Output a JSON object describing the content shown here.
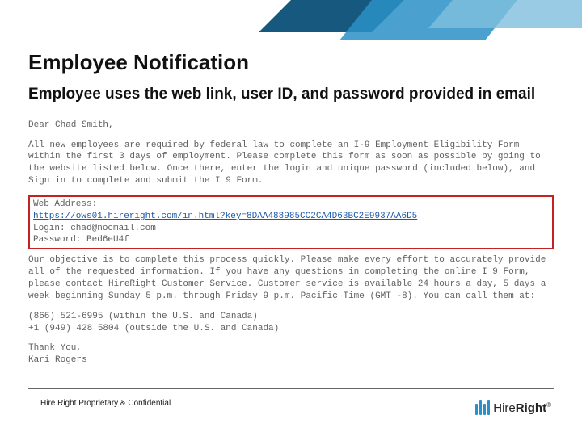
{
  "title": "Employee Notification",
  "subtitle": "Employee uses the web link, user ID, and password provided in email",
  "email": {
    "greeting": "Dear Chad Smith,",
    "intro": "All new employees are required by federal law to complete an I-9 Employment Eligibility Form within the first 3 days of employment. Please complete this form as soon as possible by going to the website listed below. Once there, enter the login and unique password (included below), and Sign in to complete and submit the I 9 Form.",
    "web_label": "Web Address:",
    "web_url": "https://ows01.hireright.com/in.html?key=8DAA488985CC2CA4D63BC2E9937AA6D5",
    "login_line": "Login: chad@nocmail.com",
    "password_line": "Password: Bed6eU4f",
    "body2": "Our objective is to complete this process quickly. Please make every effort to accurately provide all of the requested information. If you have any questions in completing the online I 9 Form, please contact HireRight Customer Service. Customer service is available 24 hours a day, 5 days a week beginning Sunday 5 p.m. through Friday 9 p.m. Pacific Time (GMT -8). You can call them at:",
    "phone1": "(866) 521-6995 (within the U.S. and Canada)",
    "phone2": "+1 (949) 428 5804 (outside the U.S. and Canada)",
    "closing1": "Thank You,",
    "closing2": "Kari Rogers"
  },
  "footer": "Hire.Right Proprietary & Confidential",
  "logo": {
    "first": "Hire",
    "second": "Right"
  }
}
